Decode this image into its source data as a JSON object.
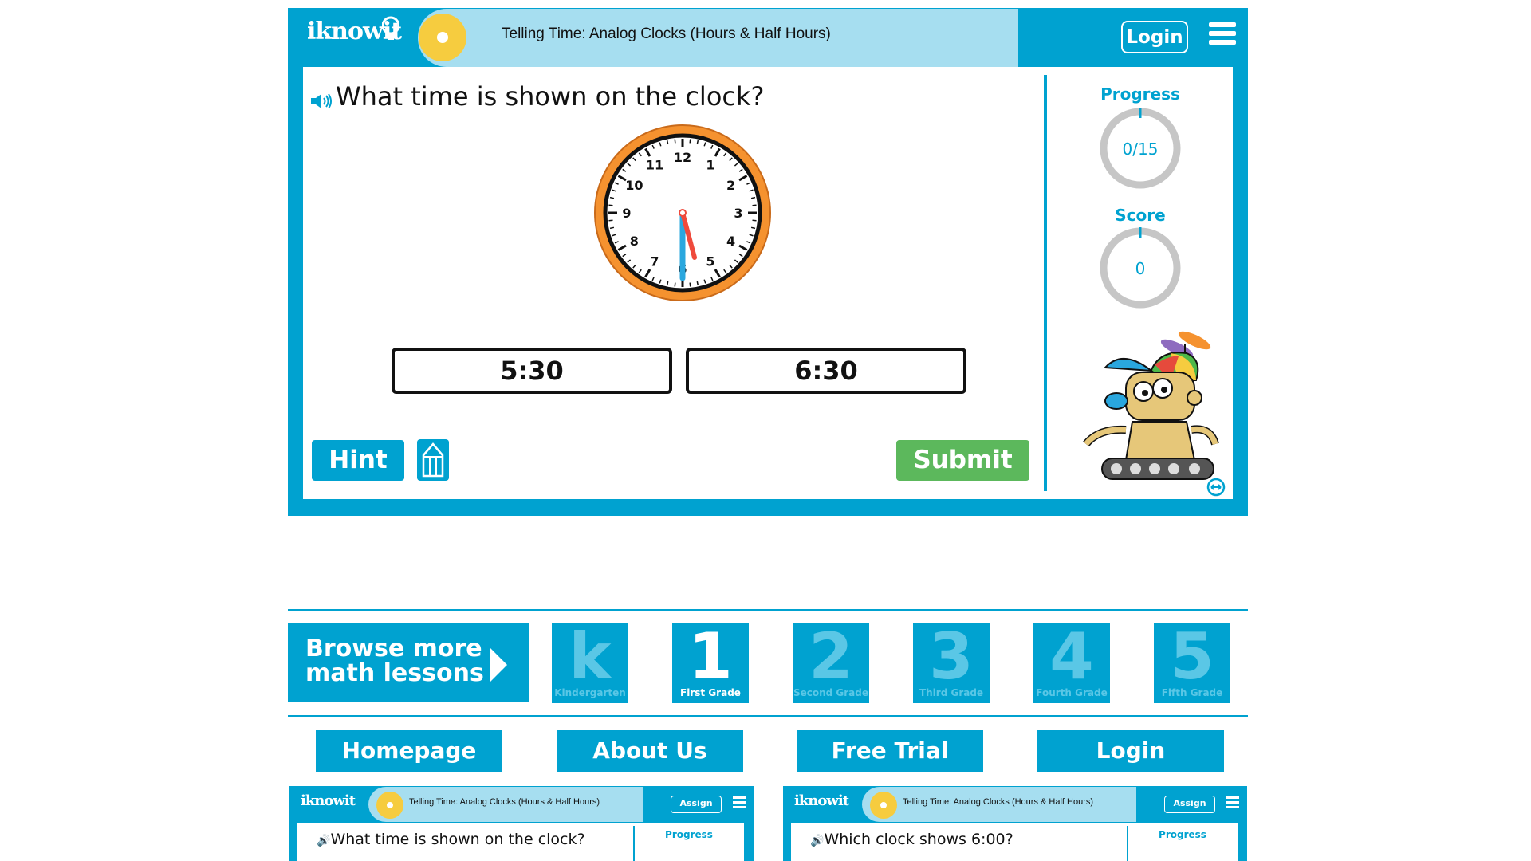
{
  "app": {
    "logo": "iknowit",
    "lesson_title": "Telling Time: Analog Clocks (Hours & Half Hours)",
    "login_label": "Login",
    "question": "What time is shown on the clock?",
    "clock": {
      "hour": 5,
      "minute": 30,
      "numbers": [
        "12",
        "1",
        "2",
        "3",
        "4",
        "5",
        "6",
        "7",
        "8",
        "9",
        "10",
        "11"
      ]
    },
    "answers": [
      "5:30",
      "6:30"
    ],
    "hint_label": "Hint",
    "submit_label": "Submit",
    "progress": {
      "label": "Progress",
      "value": "0/15"
    },
    "score": {
      "label": "Score",
      "value": "0"
    },
    "colors": {
      "brand": "#00a2d0",
      "title_pill": "#a6def0",
      "submit": "#5cb85c",
      "clock_rim": "#f5922f",
      "hour_hand": "#ef4a3c",
      "minute_hand": "#2aa7de"
    }
  },
  "browse": {
    "line1": "Browse more",
    "line2": "math lessons"
  },
  "grades": [
    {
      "big": "k",
      "small": "Kindergarten",
      "active": false
    },
    {
      "big": "1",
      "small": "First Grade",
      "active": true
    },
    {
      "big": "2",
      "small": "Second Grade",
      "active": false
    },
    {
      "big": "3",
      "small": "Third Grade",
      "active": false
    },
    {
      "big": "4",
      "small": "Fourth Grade",
      "active": false
    },
    {
      "big": "5",
      "small": "Fifth Grade",
      "active": false
    }
  ],
  "footer_nav": [
    "Homepage",
    "About Us",
    "Free Trial",
    "Login"
  ],
  "thumbnails": [
    {
      "logo": "iknowit",
      "title": "Telling Time: Analog Clocks (Hours & Half Hours)",
      "assign": "Assign",
      "question": "What time is shown on the clock?",
      "progress": "Progress"
    },
    {
      "logo": "iknowit",
      "title": "Telling Time: Analog Clocks (Hours & Half Hours)",
      "assign": "Assign",
      "question": "Which clock shows 6:00?",
      "progress": "Progress"
    }
  ]
}
